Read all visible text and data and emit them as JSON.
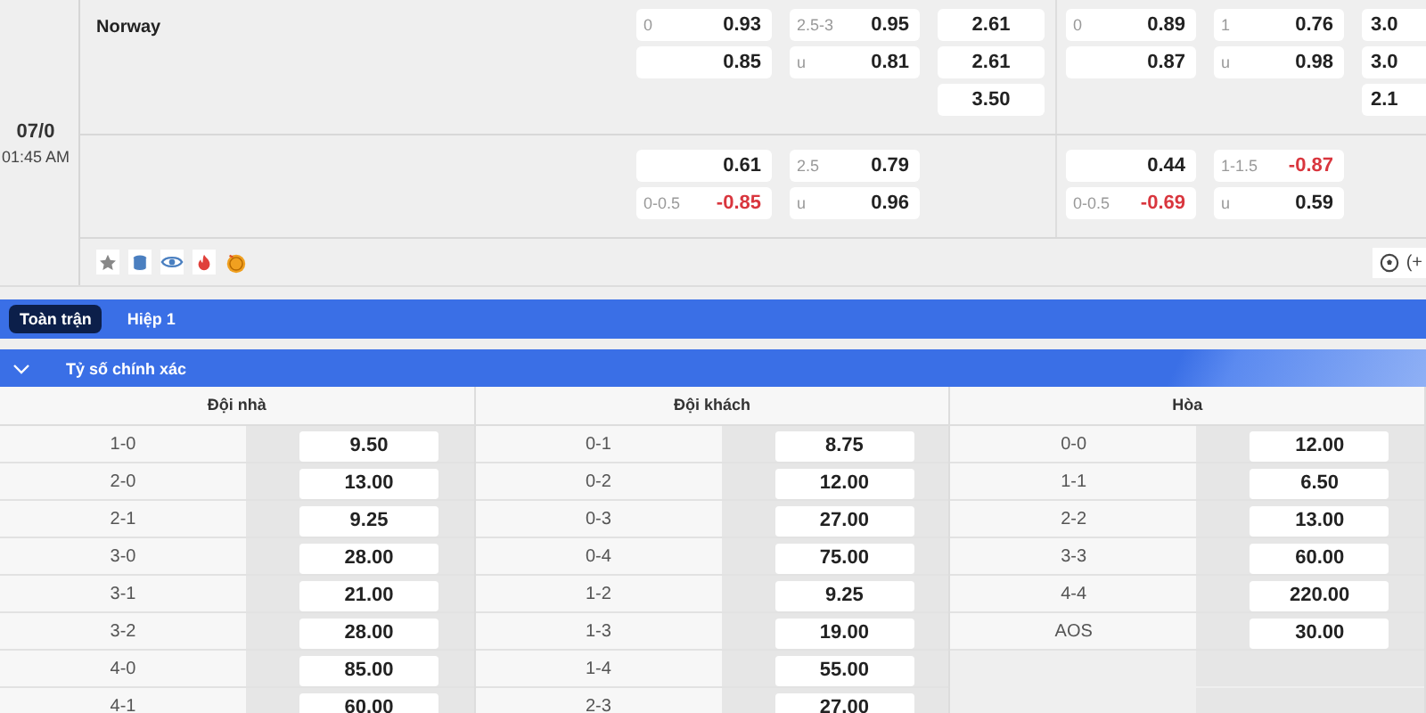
{
  "match": {
    "team": "Norway",
    "date": "07/0",
    "time": "01:45 AM",
    "rows": [
      [
        [
          {
            "line": "0",
            "value": "0.93",
            "negative": false
          },
          {
            "value": "0.85",
            "negative": false
          }
        ],
        [
          {
            "line": "2.5-3",
            "value": "0.95",
            "negative": false
          },
          {
            "line": "u",
            "value": "0.81",
            "negative": false
          }
        ],
        [
          {
            "value": "2.61",
            "negative": false
          },
          {
            "value": "2.61",
            "negative": false
          },
          {
            "value": "3.50",
            "negative": false
          }
        ],
        [
          {
            "line": "0",
            "value": "0.89",
            "negative": false
          },
          {
            "value": "0.87",
            "negative": false
          }
        ],
        [
          {
            "line": "1",
            "value": "0.76",
            "negative": false
          },
          {
            "line": "u",
            "value": "0.98",
            "negative": false
          }
        ],
        [
          {
            "value": "3.0",
            "negative": false
          },
          {
            "value": "3.0",
            "negative": false
          },
          {
            "value": "2.1",
            "negative": false
          }
        ]
      ],
      [
        [
          {
            "value": "0.61",
            "negative": false
          },
          {
            "line": "0-0.5",
            "value": "-0.85",
            "negative": true
          }
        ],
        [
          {
            "line": "2.5",
            "value": "0.79",
            "negative": false
          },
          {
            "line": "u",
            "value": "0.96",
            "negative": false
          }
        ],
        [],
        [
          {
            "value": "0.44",
            "negative": false
          },
          {
            "line": "0-0.5",
            "value": "-0.69",
            "negative": true
          }
        ],
        [
          {
            "line": "1-1.5",
            "value": "-0.87",
            "negative": true
          },
          {
            "line": "u",
            "value": "0.59",
            "negative": false
          }
        ],
        []
      ]
    ],
    "tools": [
      {
        "kind": "star"
      },
      {
        "kind": "database"
      },
      {
        "kind": "eye"
      },
      {
        "kind": "fire"
      },
      {
        "kind": "coin"
      }
    ],
    "more_label": "(+"
  },
  "tabs": [
    {
      "label": "Toàn trận",
      "selected": true
    },
    {
      "label": "Hiệp 1",
      "selected": false
    }
  ],
  "market": {
    "title": "Tỷ số chính xác",
    "expanded": true,
    "groups": [
      {
        "heading": "Đội nhà",
        "rows": [
          {
            "score": "1-0",
            "odds": "9.50"
          },
          {
            "score": "2-0",
            "odds": "13.00"
          },
          {
            "score": "2-1",
            "odds": "9.25"
          },
          {
            "score": "3-0",
            "odds": "28.00"
          },
          {
            "score": "3-1",
            "odds": "21.00"
          },
          {
            "score": "3-2",
            "odds": "28.00"
          },
          {
            "score": "4-0",
            "odds": "85.00"
          },
          {
            "score": "4-1",
            "odds": "60.00"
          }
        ]
      },
      {
        "heading": "Đội khách",
        "rows": [
          {
            "score": "0-1",
            "odds": "8.75"
          },
          {
            "score": "0-2",
            "odds": "12.00"
          },
          {
            "score": "0-3",
            "odds": "27.00"
          },
          {
            "score": "0-4",
            "odds": "75.00"
          },
          {
            "score": "1-2",
            "odds": "9.25"
          },
          {
            "score": "1-3",
            "odds": "19.00"
          },
          {
            "score": "1-4",
            "odds": "55.00"
          },
          {
            "score": "2-3",
            "odds": "27.00"
          }
        ]
      },
      {
        "heading": "Hòa",
        "rows": [
          {
            "score": "0-0",
            "odds": "12.00"
          },
          {
            "score": "1-1",
            "odds": "6.50"
          },
          {
            "score": "2-2",
            "odds": "13.00"
          },
          {
            "score": "3-3",
            "odds": "60.00"
          },
          {
            "score": "4-4",
            "odds": "220.00"
          },
          {
            "score": "AOS",
            "odds": "30.00"
          }
        ]
      }
    ]
  }
}
